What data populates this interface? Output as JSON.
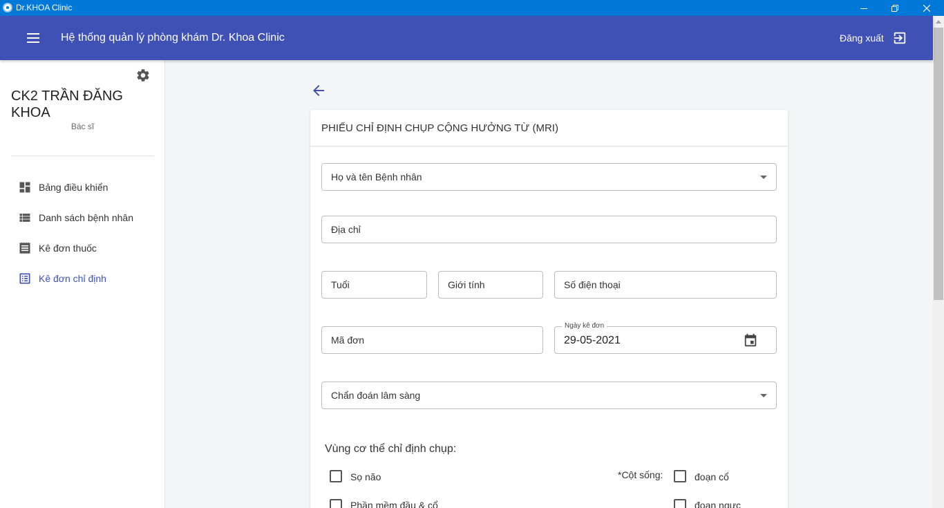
{
  "window": {
    "title": "Dr.KHOA Clinic"
  },
  "appbar": {
    "title": "Hệ thống quản lý phòng khám Dr. Khoa Clinic",
    "logout_label": "Đăng xuất"
  },
  "sidebar": {
    "doctor_name": "CK2 TRẦN ĐĂNG KHOA",
    "doctor_role": "Bác sĩ",
    "items": [
      {
        "label": "Bảng điều khiển",
        "icon": "dashboard-icon"
      },
      {
        "label": "Danh sách bệnh nhân",
        "icon": "list-icon"
      },
      {
        "label": "Kê đơn thuốc",
        "icon": "receipt-icon"
      },
      {
        "label": "Kê đơn chỉ định",
        "icon": "list-alt-icon",
        "active": true
      }
    ]
  },
  "form": {
    "title": "PHIẾU CHỈ ĐỊNH CHỤP CỘNG HƯỞNG TỪ (MRI)",
    "patient_name_placeholder": "Họ và tên Bệnh nhân",
    "address_placeholder": "Địa chỉ",
    "age_placeholder": "Tuổi",
    "gender_placeholder": "Giới tính",
    "phone_placeholder": "Số điện thoại",
    "order_code_placeholder": "Mã đơn",
    "date_label": "Ngày kê đơn",
    "date_value": "29-05-2021",
    "diagnosis_placeholder": "Chẩn đoán lâm sàng",
    "region_label": "Vùng cơ thể chỉ định chụp:",
    "spine_label": "*Cột sống:",
    "checkboxes": {
      "so_nao": "Sọ não",
      "phan_mem": "Phần mềm đầu & cổ",
      "doan_co": "đoạn cổ",
      "doan_nguc": "đoạn ngực"
    }
  },
  "colors": {
    "primary": "#3f51b5",
    "titlebar": "#0078d7",
    "background": "#f4f5f7"
  }
}
